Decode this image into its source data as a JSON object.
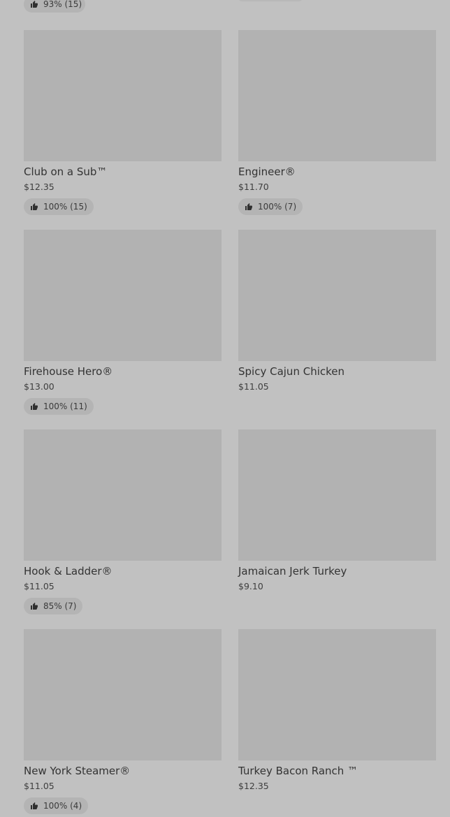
{
  "top_partial": {
    "rating": "93% (15)"
  },
  "items": [
    {
      "name": "Club on a Sub™",
      "price": "$12.35",
      "rating": "100% (15)"
    },
    {
      "name": "Engineer®",
      "price": "$11.70",
      "rating": "100% (7)"
    },
    {
      "name": "Firehouse Hero®",
      "price": "$13.00",
      "rating": "100% (11)"
    },
    {
      "name": "Spicy Cajun Chicken",
      "price": "$11.05",
      "rating": null
    },
    {
      "name": "Hook & Ladder®",
      "price": "$11.05",
      "rating": "85% (7)"
    },
    {
      "name": "Jamaican Jerk Turkey",
      "price": "$9.10",
      "rating": null
    },
    {
      "name": "New York Steamer®",
      "price": "$11.05",
      "rating": "100% (4)"
    },
    {
      "name": "Turkey Bacon Ranch ™",
      "price": "$12.35",
      "rating": null
    }
  ],
  "icons": {
    "rating": "thumbs-up-icon"
  },
  "colors": {
    "background": "#c1c1c1",
    "image_placeholder": "#b2b2b2",
    "badge": "#b4b4b4",
    "text": "#333333"
  }
}
